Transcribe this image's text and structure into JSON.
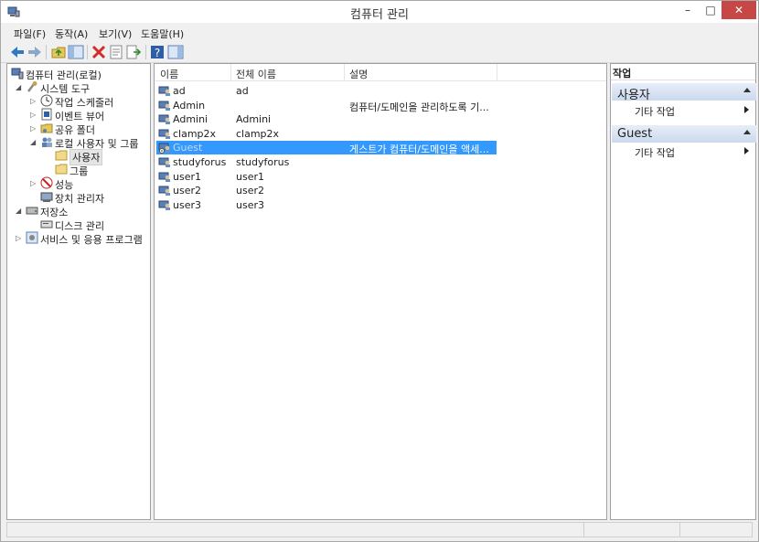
{
  "window": {
    "title": "컴퓨터 관리",
    "min": "–",
    "max": "□",
    "close": "✕"
  },
  "menu": [
    "파일(F)",
    "동작(A)",
    "보기(V)",
    "도움말(H)"
  ],
  "tree": [
    {
      "label": "컴퓨터 관리(로컬)",
      "icon": "computer-management-icon",
      "level": 0,
      "exp": ""
    },
    {
      "label": "시스템 도구",
      "icon": "system-tools-icon",
      "level": 1,
      "exp": "◢"
    },
    {
      "label": "작업 스케줄러",
      "icon": "clock-icon",
      "level": 2,
      "exp": "▷"
    },
    {
      "label": "이벤트 뷰어",
      "icon": "event-viewer-icon",
      "level": 2,
      "exp": "▷"
    },
    {
      "label": "공유 폴더",
      "icon": "shared-folder-icon",
      "level": 2,
      "exp": "▷"
    },
    {
      "label": "로컬 사용자 및 그룹",
      "icon": "users-groups-icon",
      "level": 2,
      "exp": "◢"
    },
    {
      "label": "사용자",
      "icon": "folder-icon",
      "level": 3,
      "exp": "",
      "selected": true
    },
    {
      "label": "그룹",
      "icon": "folder-icon",
      "level": 3,
      "exp": ""
    },
    {
      "label": "성능",
      "icon": "performance-icon",
      "level": 2,
      "exp": "▷"
    },
    {
      "label": "장치 관리자",
      "icon": "device-manager-icon",
      "level": 2,
      "exp": ""
    },
    {
      "label": "저장소",
      "icon": "storage-icon",
      "level": 1,
      "exp": "◢"
    },
    {
      "label": "디스크 관리",
      "icon": "disk-icon",
      "level": 2,
      "exp": ""
    },
    {
      "label": "서비스 및 응용 프로그램",
      "icon": "services-icon",
      "level": 1,
      "exp": "▷"
    }
  ],
  "list": {
    "columns": [
      "이름",
      "전체 이름",
      "설명"
    ],
    "rows": [
      {
        "name": "ad",
        "full": "ad",
        "desc": ""
      },
      {
        "name": "Admin",
        "full": "",
        "desc": "컴퓨터/도메인을 관리하도록 기..."
      },
      {
        "name": "Admini",
        "full": "Admini",
        "desc": ""
      },
      {
        "name": "clamp2x",
        "full": "clamp2x",
        "desc": ""
      },
      {
        "name": "Guest",
        "full": "",
        "desc": "게스트가 컴퓨터/도메인을 액세...",
        "selected": true,
        "disabled": true
      },
      {
        "name": "studyforus",
        "full": "studyforus",
        "desc": ""
      },
      {
        "name": "user1",
        "full": "user1",
        "desc": ""
      },
      {
        "name": "user2",
        "full": "user2",
        "desc": ""
      },
      {
        "name": "user3",
        "full": "user3",
        "desc": ""
      }
    ]
  },
  "actions": {
    "title": "작업",
    "sections": [
      {
        "header": "사용자",
        "items": [
          "기타 작업"
        ]
      },
      {
        "header": "Guest",
        "items": [
          "기타 작업"
        ]
      }
    ]
  },
  "colors": {
    "selection": "#3399ff",
    "close": "#c74747",
    "actionHeader": "#cbd9ee"
  }
}
